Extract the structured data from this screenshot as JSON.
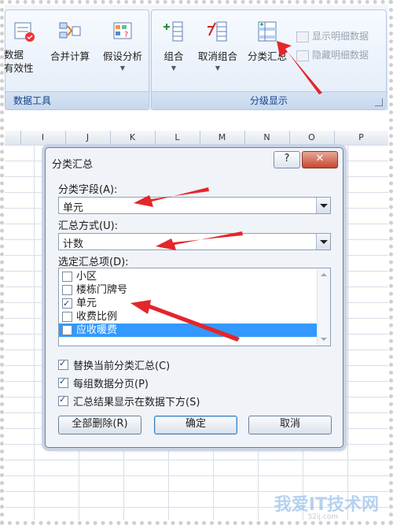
{
  "ribbon": {
    "data_tools": {
      "validation_label": "数据\n有效性",
      "consolidate_label": "合并计算",
      "whatif_label": "假设分析",
      "caption": "数据工具"
    },
    "outline": {
      "group_label": "组合",
      "ungroup_label": "取消组合",
      "subtotal_label": "分类汇总",
      "show_detail_label": "显示明细数据",
      "hide_detail_label": "隐藏明细数据",
      "caption": "分级显示"
    }
  },
  "sheet": {
    "columns": [
      "I",
      "J",
      "K",
      "L",
      "M",
      "N",
      "O",
      "P"
    ]
  },
  "dialog": {
    "title": "分类汇总",
    "help": "?",
    "close": "✕",
    "field_label": "分类字段(A):",
    "field_value": "单元",
    "func_label": "汇总方式(U):",
    "func_value": "计数",
    "items_label": "选定汇总项(D):",
    "items": [
      {
        "label": "小区",
        "checked": false,
        "selected": false
      },
      {
        "label": "楼栋门牌号",
        "checked": false,
        "selected": false
      },
      {
        "label": "单元",
        "checked": true,
        "selected": false
      },
      {
        "label": "收费比例",
        "checked": false,
        "selected": false
      },
      {
        "label": "应收暖费",
        "checked": false,
        "selected": true
      }
    ],
    "opt_replace": "替换当前分类汇总(C)",
    "opt_pagebreak": "每组数据分页(P)",
    "opt_summary_below": "汇总结果显示在数据下方(S)",
    "btn_remove_all": "全部删除(R)",
    "btn_ok": "确定",
    "btn_cancel": "取消"
  },
  "watermark": {
    "text": "我爱IT技术网",
    "sub": "52ij.com"
  },
  "colors": {
    "selection": "#3399ff",
    "annotation_arrow": "#e3262b"
  }
}
